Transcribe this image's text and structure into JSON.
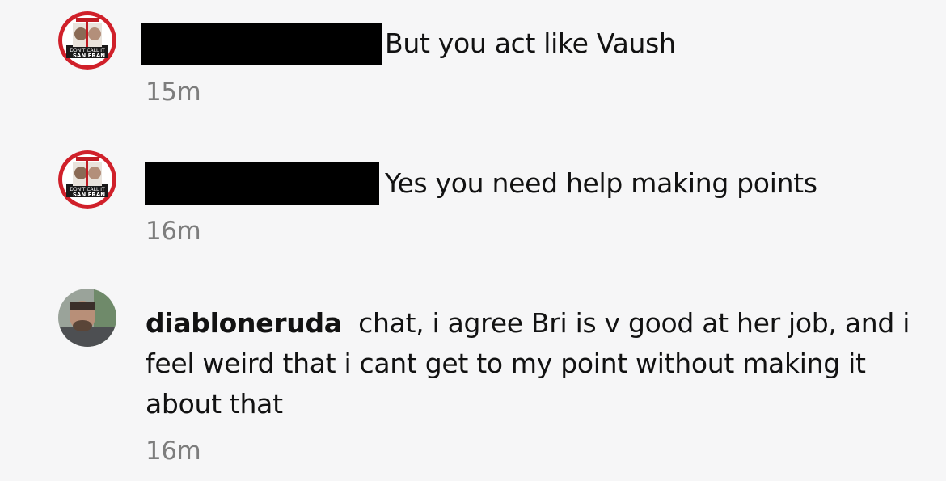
{
  "comments": [
    {
      "time": "15m",
      "text": "But you act like Vaush",
      "avatar_icon": "podcast-logo-avatar"
    },
    {
      "time": "16m",
      "text": "Yes you need help making points",
      "avatar_icon": "podcast-logo-avatar"
    },
    {
      "username": "diabloneruda",
      "text": "chat, i agree  Bri is v good at her job, and i feel weird that i cant  get to my point without making it about that",
      "time": "16m",
      "avatar_icon": "user-photo-avatar"
    }
  ],
  "colors": {
    "background": "#f6f6f7",
    "text": "#121212",
    "timestamp": "#7d7d7d",
    "redaction": "#000000",
    "logo_red": "#d0202a"
  }
}
